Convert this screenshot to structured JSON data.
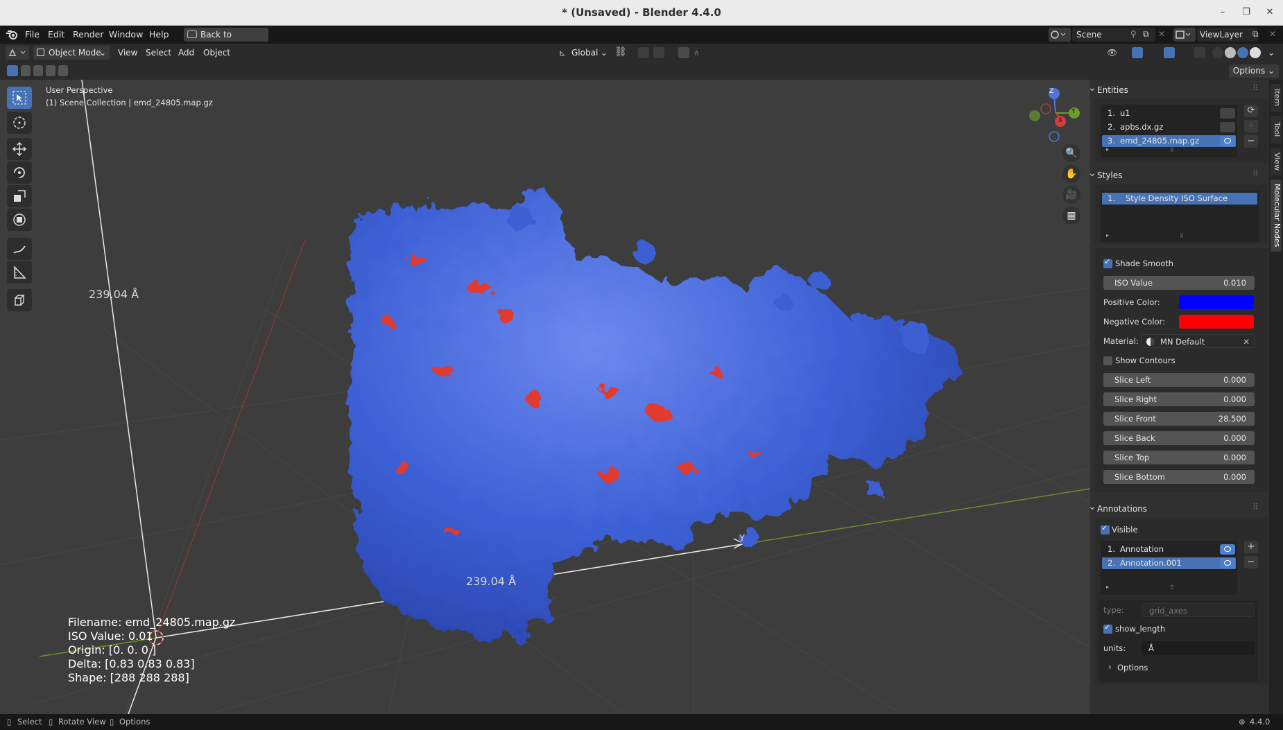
{
  "window": {
    "title": "* (Unsaved) - Blender 4.4.0"
  },
  "menubar": {
    "items": [
      "File",
      "Edit",
      "Render",
      "Window",
      "Help"
    ],
    "back_button": "Back to Previous",
    "scene": "Scene",
    "view_layer": "ViewLayer"
  },
  "header": {
    "mode": "Object Mode",
    "menus": [
      "View",
      "Select",
      "Add",
      "Object"
    ],
    "transform_orientation": "Global",
    "options": "Options"
  },
  "viewport": {
    "perspective": "User Perspective",
    "collection": "(1) Scene Collection | emd_24805.map.gz",
    "measure_vertical": "239.04 Å",
    "measure_horizontal": "239.04 Å",
    "axis_y_label": "Y",
    "gizmo": {
      "z": "Z",
      "y": "Y",
      "x": "X"
    },
    "info": [
      "Filename: emd_24805.map.gz",
      "ISO Value: 0.01",
      "Origin: [0. 0. 0.]",
      "Delta: [0.83 0.83 0.83]",
      "Shape: [288 288 288]"
    ],
    "colors": {
      "positive": "#4163d6",
      "negative": "#e03b2e",
      "background": "#3d3d3d"
    }
  },
  "sidebar_tabs": [
    "Item",
    "Tool",
    "View",
    "Molecular Nodes"
  ],
  "entities": {
    "title": "Entities",
    "items": [
      {
        "index": "1.",
        "name": "u1"
      },
      {
        "index": "2.",
        "name": "apbs.dx.gz"
      },
      {
        "index": "3.",
        "name": "emd_24805.map.gz"
      }
    ]
  },
  "styles": {
    "title": "Styles",
    "items": [
      {
        "index": "1.",
        "name": "Style Density ISO Surface"
      }
    ],
    "shade_smooth": "Shade Smooth",
    "iso_value_label": "ISO Value",
    "iso_value": "0.010",
    "positive_color_label": "Positive Color:",
    "positive_color": "#0000ff",
    "negative_color_label": "Negative Color:",
    "negative_color": "#ff0000",
    "material_label": "Material:",
    "material": "MN Default",
    "show_contours": "Show Contours",
    "slices": [
      {
        "label": "Slice Left",
        "value": "0.000"
      },
      {
        "label": "Slice Right",
        "value": "0.000"
      },
      {
        "label": "Slice Front",
        "value": "28.500"
      },
      {
        "label": "Slice Back",
        "value": "0.000"
      },
      {
        "label": "Slice Top",
        "value": "0.000"
      },
      {
        "label": "Slice Bottom",
        "value": "0.000"
      }
    ]
  },
  "annotations": {
    "title": "Annotations",
    "visible": "Visible",
    "items": [
      {
        "index": "1.",
        "name": "Annotation"
      },
      {
        "index": "2.",
        "name": "Annotation.001"
      }
    ],
    "type_label": "type:",
    "type_value": "grid_axes",
    "show_length": "show_length",
    "units_label": "units:",
    "units_value": "Å",
    "options": "Options"
  },
  "statusbar": {
    "select": "Select",
    "rotate": "Rotate View",
    "options": "Options",
    "version": "4.4.0"
  }
}
